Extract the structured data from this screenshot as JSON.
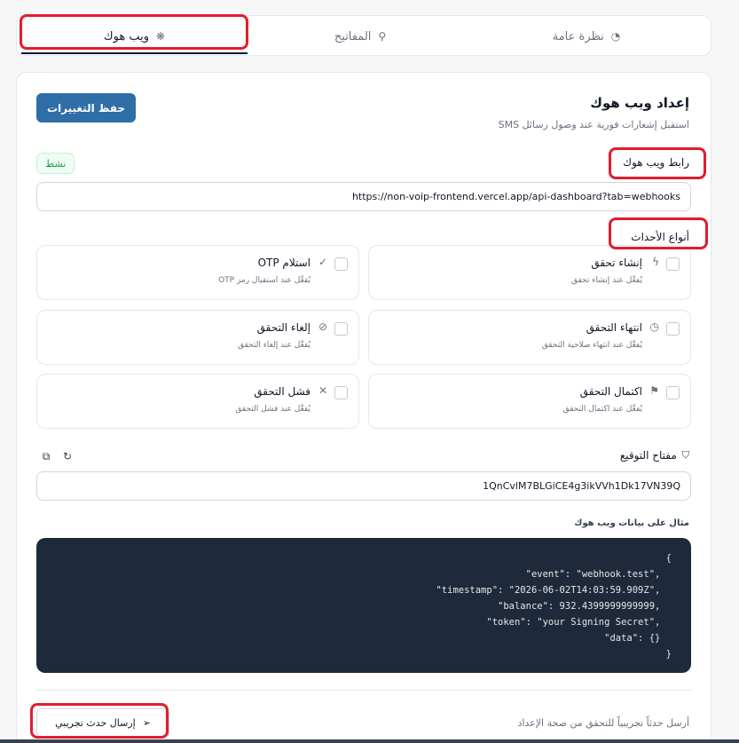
{
  "tabs": [
    {
      "label": "ويب هوك",
      "icon": "webhook-icon",
      "active": true
    },
    {
      "label": "المفاتيح",
      "icon": "key-icon",
      "active": false
    },
    {
      "label": "نظرة عامة",
      "icon": "gauge-icon",
      "active": false
    }
  ],
  "header": {
    "title": "إعداد ويب هوك",
    "subtitle": "استقبل إشعارات فورية عند وصول رسائل SMS",
    "save_label": "حفظ التغييرات"
  },
  "webhook": {
    "label": "رابط ويب هوك",
    "status": "نشط",
    "url": "https://non-voip-frontend.vercel.app/api-dashboard?tab=webhooks"
  },
  "events": {
    "label": "أنواع الأحداث",
    "items": [
      {
        "name": "إنشاء تحقق",
        "desc": "يُفعَّل عند إنشاء تحقق",
        "icon": "bolt-icon",
        "checked": false
      },
      {
        "name": "استلام OTP",
        "desc": "يُفعَّل عند استقبال رمز OTP",
        "icon": "check-circle-icon",
        "checked": false
      },
      {
        "name": "انتهاء التحقق",
        "desc": "يُفعَّل عند انتهاء صلاحية التحقق",
        "icon": "clock-icon",
        "checked": false
      },
      {
        "name": "إلغاء التحقق",
        "desc": "يُفعَّل عند إلغاء التحقق",
        "icon": "ban-icon",
        "checked": false
      },
      {
        "name": "اكتمال التحقق",
        "desc": "يُفعَّل عند اكتمال التحقق",
        "icon": "flag-icon",
        "checked": false
      },
      {
        "name": "فشل التحقق",
        "desc": "يُفعَّل عند فشل التحقق",
        "icon": "x-icon",
        "checked": false
      }
    ]
  },
  "signing": {
    "label": "مفتاح التوقيع",
    "value": "1QnCvlM7BLGiCE4g3ikVVh1Dk17VN39Q"
  },
  "payload": {
    "label": "مثال على بيانات ويب هوك",
    "lines": [
      "}",
      "  ,\"event\": \"webhook.test\"",
      "  ,\"timestamp\": \"2026-06-02T14:03:59.909Z\"",
      "  ,balance\": 932.4399999999999\"",
      "  ,\"token\": \"your Signing Secret\"",
      "  {} :\"data\"",
      "{"
    ]
  },
  "test": {
    "text": "أرسل حدثاً تجريبياً للتحقق من صحة الإعداد",
    "button_label": "إرسال حدث تجريبي"
  },
  "colors": {
    "primary": "#2f6ea7",
    "highlight": "#e11d2e",
    "code_bg": "#1e293b",
    "success": "#16a34a"
  }
}
